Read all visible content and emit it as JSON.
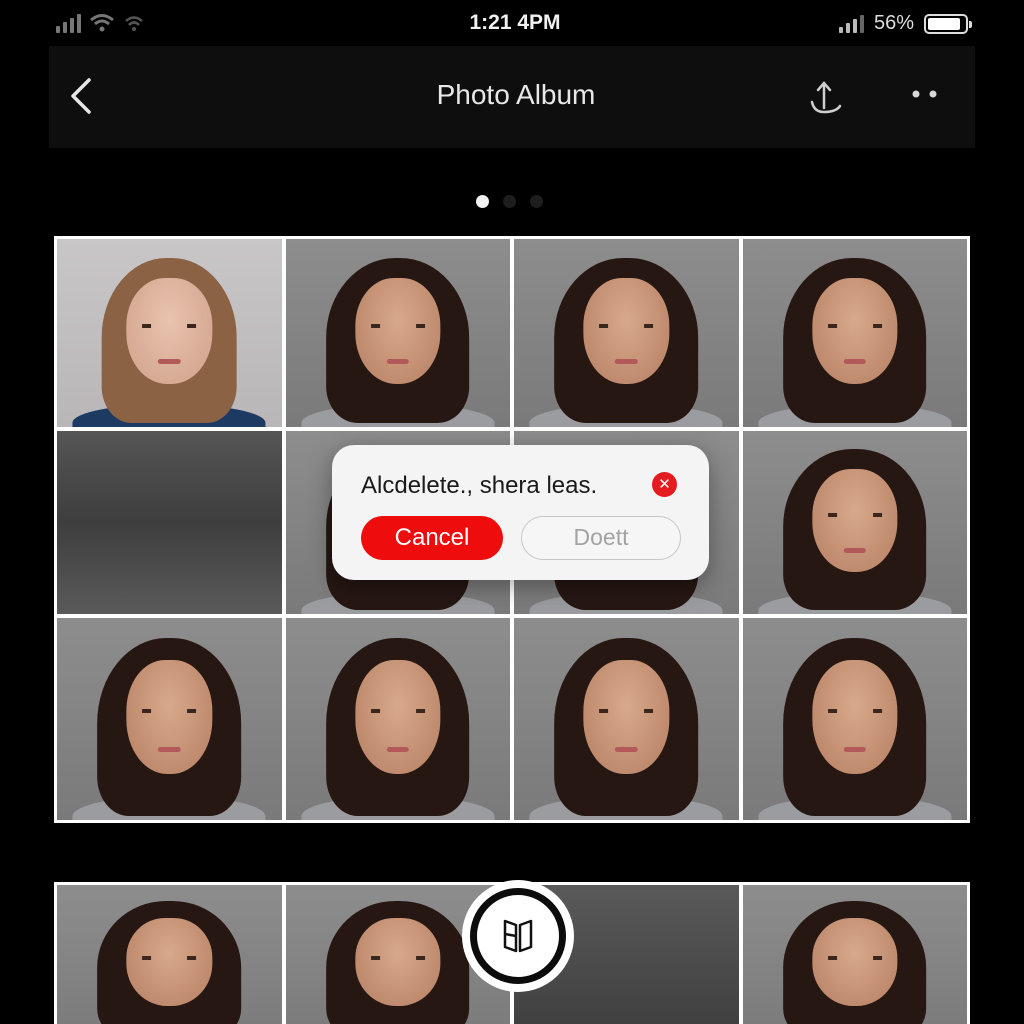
{
  "status_bar": {
    "time": "1:21 4PM",
    "battery_percent_label": "56%",
    "battery_level": 0.9
  },
  "nav": {
    "title": "Photo Album",
    "back_icon": "chevron-left-icon",
    "share_icon": "share-icon",
    "more_icon": "more-dots-icon"
  },
  "pager": {
    "count": 3,
    "active": 1
  },
  "dialog": {
    "message": "Alcdelete.,  shera leas.",
    "cancel_label": "Cancel",
    "delete_label": "Doett",
    "close_icon": "close-icon"
  },
  "fab": {
    "icon": "book-icon"
  },
  "colors": {
    "background": "#000000",
    "navbar": "#0e0e0e",
    "accent_red": "#ee0c0c",
    "dialog_bg": "#f4f4f4",
    "grid_border": "#ffffff"
  }
}
